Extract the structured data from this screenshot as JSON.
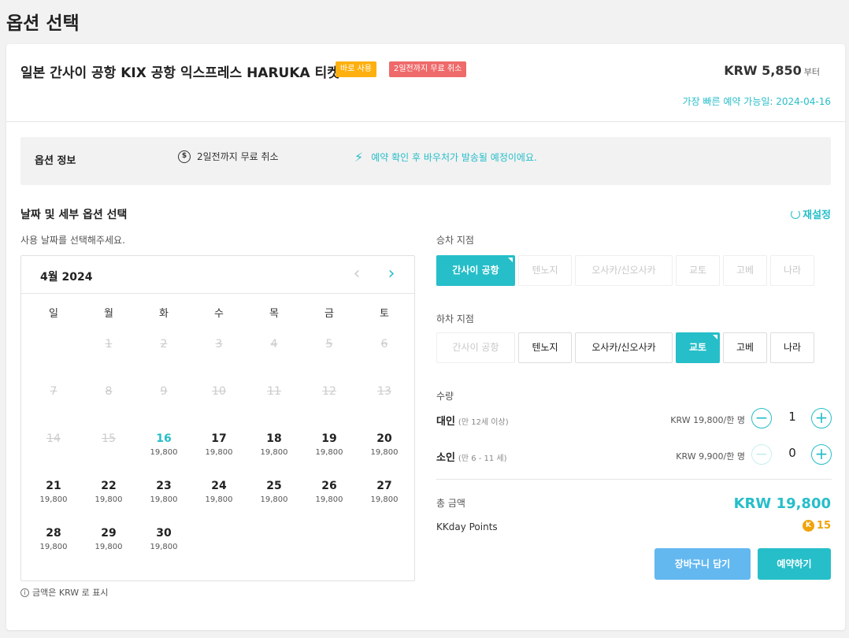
{
  "page_title": "옵션 선택",
  "product": {
    "title": "일본 간사이 공항 KIX 공항 익스프레스 HARUKA 티켓",
    "badge_instant": "바로 사용",
    "badge_cancel": "2일전까지 무료 취소",
    "price_from": "KRW 5,850",
    "price_from_suffix": "부터",
    "earliest": "가장 빠른 예약 가능일: 2024-04-16"
  },
  "option_info": {
    "label": "옵션 정보",
    "cancel_text": "2일전까지 무료 취소",
    "cancel_icon": "$",
    "voucher_text": "예약 확인 후 바우처가 발송될 예정이에요.",
    "voucher_icon": "⚡"
  },
  "section": {
    "title": "날짜 및 세부 옵션 선택",
    "reset": "재설정",
    "date_hint": "사용 날짜를 선택해주세요."
  },
  "calendar": {
    "month": "4월 2024",
    "prev": "‹",
    "next": "›",
    "weekdays": [
      "일",
      "월",
      "화",
      "수",
      "목",
      "금",
      "토"
    ],
    "days": [
      {
        "n": "",
        "p": ""
      },
      {
        "n": "1",
        "p": ""
      },
      {
        "n": "2",
        "p": ""
      },
      {
        "n": "3",
        "p": ""
      },
      {
        "n": "4",
        "p": ""
      },
      {
        "n": "5",
        "p": ""
      },
      {
        "n": "6",
        "p": ""
      },
      {
        "n": "7",
        "p": ""
      },
      {
        "n": "8",
        "p": ""
      },
      {
        "n": "9",
        "p": ""
      },
      {
        "n": "10",
        "p": ""
      },
      {
        "n": "11",
        "p": ""
      },
      {
        "n": "12",
        "p": ""
      },
      {
        "n": "13",
        "p": ""
      },
      {
        "n": "14",
        "p": ""
      },
      {
        "n": "15",
        "p": ""
      },
      {
        "n": "16",
        "p": "19,800"
      },
      {
        "n": "17",
        "p": "19,800"
      },
      {
        "n": "18",
        "p": "19,800"
      },
      {
        "n": "19",
        "p": "19,800"
      },
      {
        "n": "20",
        "p": "19,800"
      },
      {
        "n": "21",
        "p": "19,800"
      },
      {
        "n": "22",
        "p": "19,800"
      },
      {
        "n": "23",
        "p": "19,800"
      },
      {
        "n": "24",
        "p": "19,800"
      },
      {
        "n": "25",
        "p": "19,800"
      },
      {
        "n": "26",
        "p": "19,800"
      },
      {
        "n": "27",
        "p": "19,800"
      },
      {
        "n": "28",
        "p": "19,800"
      },
      {
        "n": "29",
        "p": "19,800"
      },
      {
        "n": "30",
        "p": "19,800"
      }
    ],
    "note_icon": "i",
    "note": "금액은 KRW 로 표시"
  },
  "boarding": {
    "label": "승차 지점",
    "options": [
      "간사이 공항",
      "텐노지",
      "오사카/신오사카",
      "교토",
      "고베",
      "나라"
    ]
  },
  "alighting": {
    "label": "하차 지점",
    "options": [
      "간사이 공항",
      "텐노지",
      "오사카/신오사카",
      "교토",
      "고베",
      "나라"
    ]
  },
  "quantity": {
    "label": "수량",
    "adult": {
      "name": "대인",
      "note": "(만 12세 이상)",
      "price": "KRW 19,800/한 명",
      "value": "1"
    },
    "child": {
      "name": "소인",
      "note": "(만 6 - 11 세)",
      "price": "KRW 9,900/한 명",
      "value": "0"
    },
    "minus": "−",
    "plus": "+"
  },
  "summary": {
    "total_label": "총 금액",
    "total": "KRW 19,800",
    "points_label": "KKday Points",
    "points_icon": "K",
    "points": "15"
  },
  "buttons": {
    "cart": "장바구니 담기",
    "book": "예약하기"
  },
  "colors": {
    "accent": "#26bec9",
    "cart": "#63b8f0",
    "badge_instant": "#fdb00f",
    "badge_cancel": "#ef6a6a",
    "points": "#f0a30a"
  }
}
